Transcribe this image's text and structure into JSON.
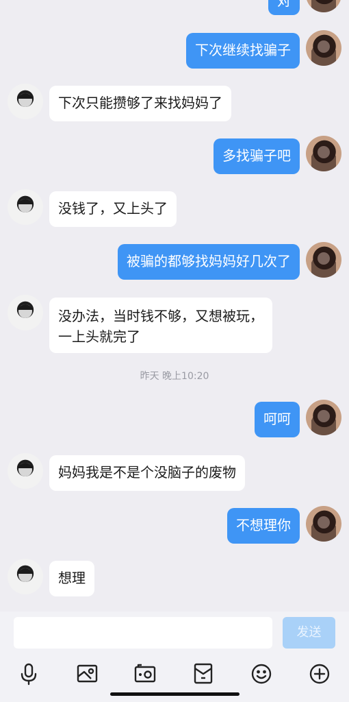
{
  "messages": [
    {
      "text": "对"
    },
    {
      "text": "下次继续找骗子"
    },
    {
      "text": "下次只能攒够了来找妈妈了"
    },
    {
      "text": "多找骗子吧"
    },
    {
      "text": "没钱了，又上头了"
    },
    {
      "text": "被骗的都够找妈妈好几次了"
    },
    {
      "text_lines": [
        "没办法，当时钱不够，又想被玩，",
        "一上头就完了"
      ]
    },
    {
      "text": "呵呵"
    },
    {
      "text": "妈妈我是不是个没脑子的废物"
    },
    {
      "text": "不想理你"
    },
    {
      "text": "想理"
    }
  ],
  "timestamp": "昨天 晚上10:20",
  "input_bar": {
    "placeholder": "",
    "send_label": "发送"
  },
  "toolbar_icons": [
    "microphone-icon",
    "image-icon",
    "camera-icon",
    "red-packet-icon",
    "emoji-icon",
    "plus-icon"
  ],
  "colors": {
    "outgoing_bubble": "#3f95f5",
    "incoming_bubble": "#ffffff",
    "background": "#eeedf2",
    "send_disabled": "#a9d1f8"
  }
}
